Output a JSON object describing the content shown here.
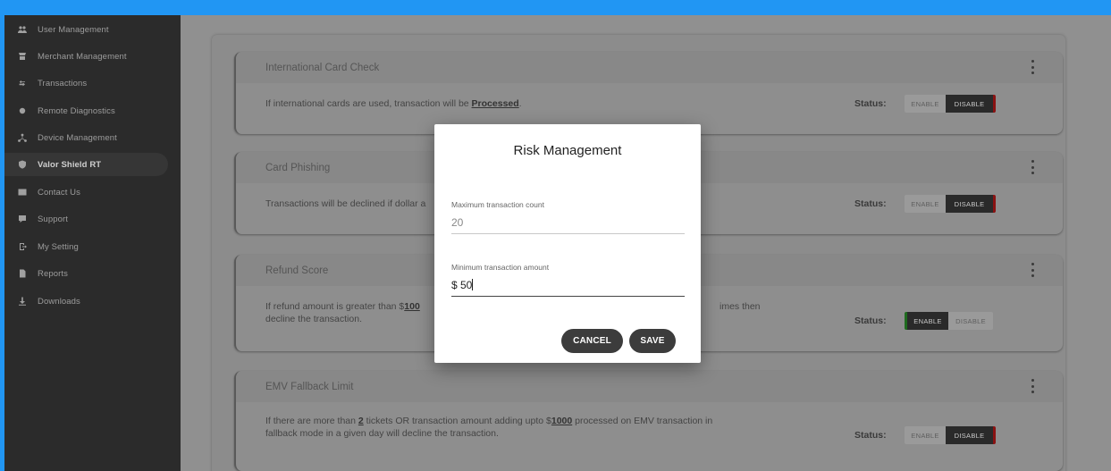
{
  "sidebar": {
    "items": [
      {
        "label": "User Management",
        "icon": "users-icon"
      },
      {
        "label": "Merchant Management",
        "icon": "store-icon"
      },
      {
        "label": "Transactions",
        "icon": "transfer-icon"
      },
      {
        "label": "Remote Diagnostics",
        "icon": "diagnostics-icon"
      },
      {
        "label": "Device Management",
        "icon": "network-icon"
      },
      {
        "label": "Valor Shield RT",
        "icon": "shield-icon",
        "active": true
      },
      {
        "label": "Contact Us",
        "icon": "contact-card-icon"
      },
      {
        "label": "Support",
        "icon": "support-icon"
      },
      {
        "label": "My Setting",
        "icon": "settings-exit-icon"
      },
      {
        "label": "Reports",
        "icon": "report-icon"
      },
      {
        "label": "Downloads",
        "icon": "download-icon"
      }
    ]
  },
  "rules": [
    {
      "title": "International Card Check",
      "desc_pre": "If international cards are used, transaction will be ",
      "desc_bold": "Processed",
      "desc_post": ".",
      "status": "disable"
    },
    {
      "title": "Card Phishing",
      "desc": "Transactions will be declined if dollar a",
      "status": "disable"
    },
    {
      "title": "Refund Score",
      "desc_pre": "If refund amount is greater than $",
      "desc_bold": "100",
      "desc_right": "imes then",
      "desc_line2": "decline the transaction.",
      "status": "enable"
    },
    {
      "title": "EMV Fallback Limit",
      "line1_a": "If there are more than ",
      "line1_b": "2",
      "line1_c": " tickets OR transaction amount adding upto $",
      "line1_d": "1000",
      "line1_e": " processed on EMV transaction in",
      "line2": "fallback mode in a given day will decline the transaction.",
      "status": "disable"
    }
  ],
  "status_label": "Status:",
  "toggle": {
    "enable": "ENABLE",
    "disable": "DISABLE"
  },
  "modal": {
    "title": "Risk Management",
    "max_count_label": "Maximum transaction count",
    "max_count_value": "20",
    "min_amount_label": "Minimum transaction amount",
    "min_amount_value": "$ 50",
    "cancel": "CANCEL",
    "save": "SAVE"
  }
}
